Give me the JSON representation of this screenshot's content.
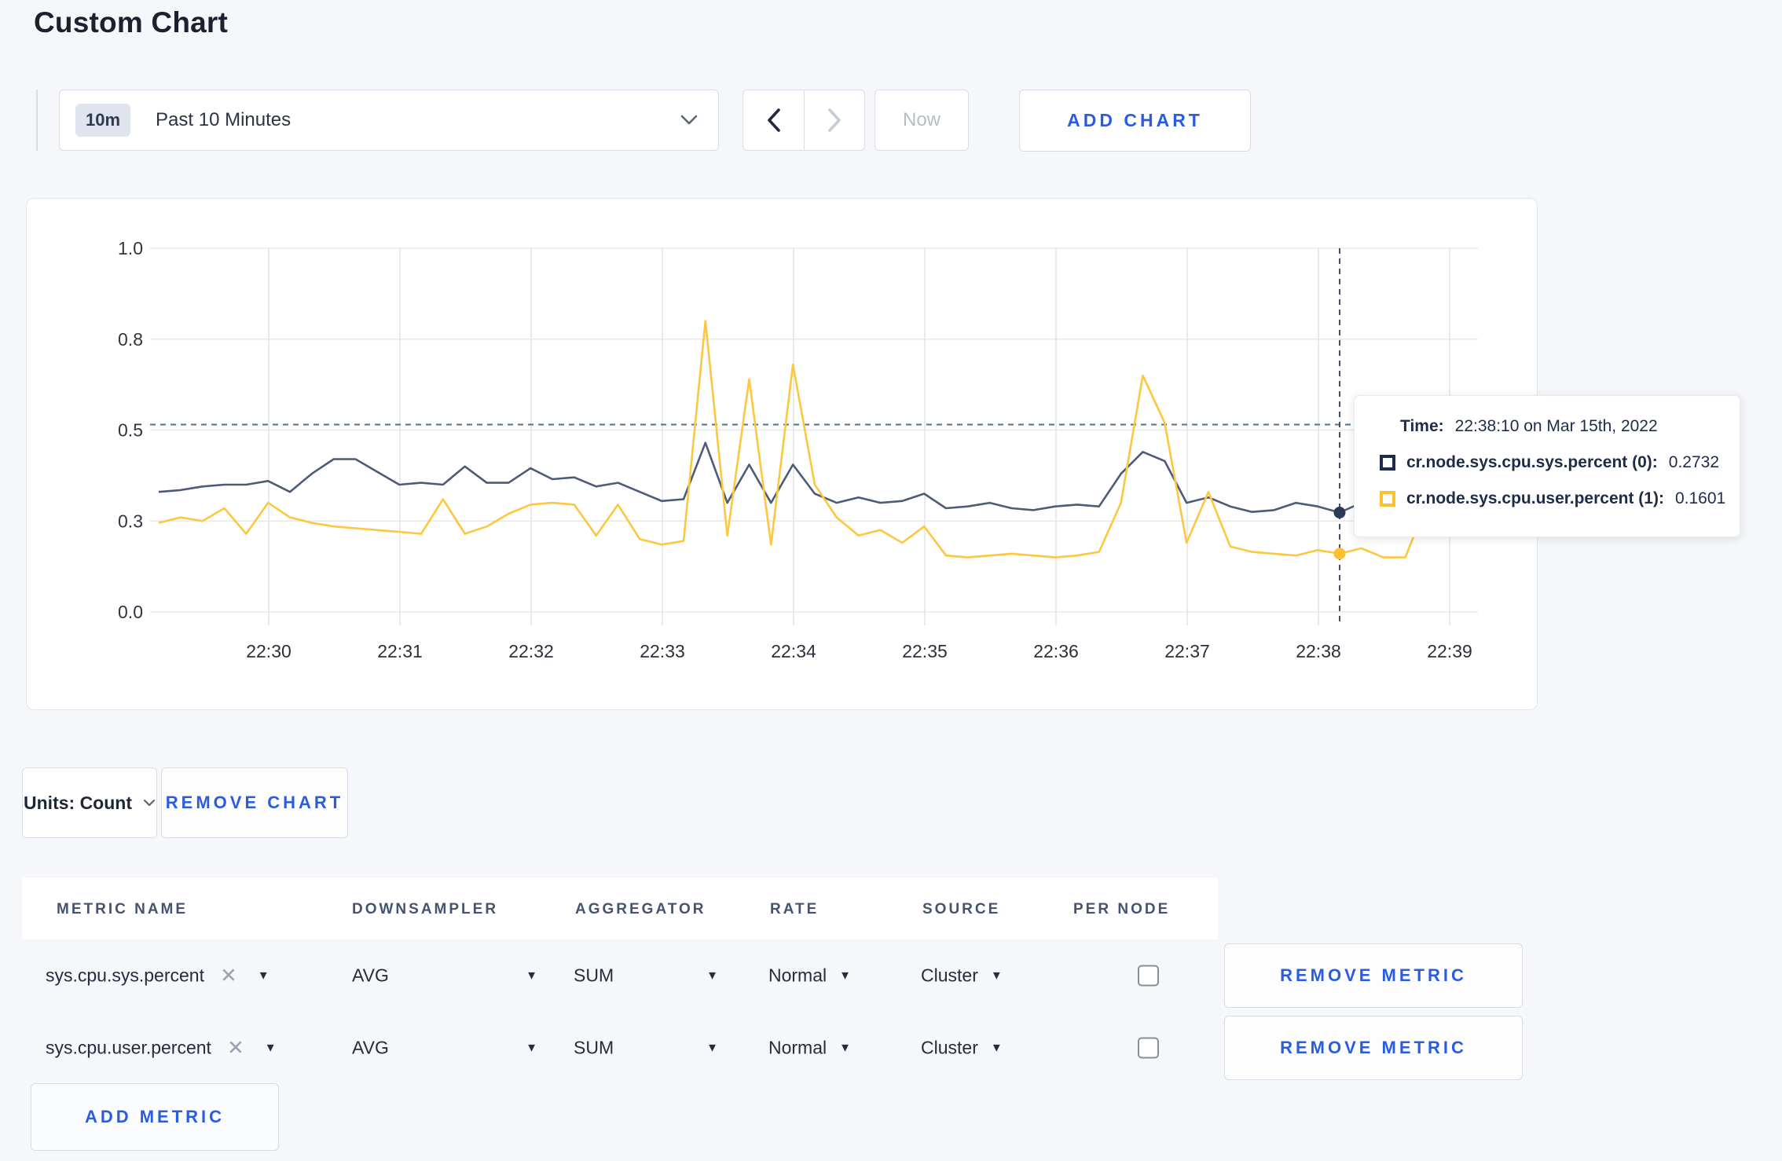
{
  "page": {
    "title": "Custom Chart",
    "background": "#f5f7fa",
    "accent_blue": "#2a5ce0"
  },
  "toolbar": {
    "time_range": {
      "badge": "10m",
      "label": "Past 10 Minutes"
    },
    "now_label": "Now",
    "add_chart_label": "ADD CHART"
  },
  "chart_data": {
    "type": "line",
    "title": "",
    "xlabel": "",
    "ylabel": "",
    "ylim": [
      0,
      1
    ],
    "grid": true,
    "start_time": "22:29:10",
    "interval_seconds": 10,
    "x_tick_labels": [
      "22:30",
      "22:31",
      "22:32",
      "22:33",
      "22:34",
      "22:35",
      "22:36",
      "22:37",
      "22:38",
      "22:39"
    ],
    "y_ticks": [
      {
        "label": "0.0",
        "value": 0.0
      },
      {
        "label": "0.3",
        "value": 0.25
      },
      {
        "label": "0.5",
        "value": 0.5
      },
      {
        "label": "0.8",
        "value": 0.75
      },
      {
        "label": "1.0",
        "value": 1.0
      }
    ],
    "series": [
      {
        "name": "cr.node.sys.cpu.sys.percent",
        "color": "#4d5b79",
        "values": [
          0.33,
          0.335,
          0.345,
          0.35,
          0.35,
          0.36,
          0.33,
          0.38,
          0.42,
          0.42,
          0.385,
          0.35,
          0.355,
          0.35,
          0.4,
          0.355,
          0.355,
          0.395,
          0.365,
          0.37,
          0.345,
          0.355,
          0.33,
          0.305,
          0.31,
          0.465,
          0.3,
          0.405,
          0.3,
          0.405,
          0.325,
          0.3,
          0.315,
          0.3,
          0.305,
          0.325,
          0.285,
          0.29,
          0.3,
          0.285,
          0.28,
          0.29,
          0.295,
          0.29,
          0.38,
          0.44,
          0.415,
          0.3,
          0.315,
          0.29,
          0.275,
          0.28,
          0.3,
          0.29,
          0.2732,
          0.3,
          0.295,
          0.29,
          0.3,
          0.295,
          0.3
        ]
      },
      {
        "name": "cr.node.sys.cpu.user.percent",
        "color": "#fdc73f",
        "values": [
          0.245,
          0.26,
          0.25,
          0.285,
          0.215,
          0.3,
          0.26,
          0.245,
          0.235,
          0.23,
          0.225,
          0.22,
          0.215,
          0.31,
          0.215,
          0.235,
          0.27,
          0.295,
          0.3,
          0.295,
          0.21,
          0.295,
          0.2,
          0.185,
          0.195,
          0.8,
          0.21,
          0.64,
          0.185,
          0.68,
          0.35,
          0.26,
          0.21,
          0.225,
          0.19,
          0.235,
          0.155,
          0.15,
          0.155,
          0.16,
          0.155,
          0.15,
          0.155,
          0.165,
          0.3,
          0.65,
          0.52,
          0.19,
          0.33,
          0.18,
          0.165,
          0.16,
          0.155,
          0.17,
          0.1601,
          0.175,
          0.15,
          0.15,
          0.3,
          0.22,
          0.27
        ]
      }
    ],
    "crosshair": {
      "index": 54,
      "time": "22:38:10",
      "hline_value": 0.515
    },
    "legend_position": "tooltip"
  },
  "tooltip": {
    "time_label": "Time:",
    "time_value": "22:38:10 on Mar 15th, 2022",
    "rows": [
      {
        "swatch_color": "#1e2c49",
        "label": "cr.node.sys.cpu.sys.percent (0):",
        "value": "0.2732"
      },
      {
        "swatch_color": "#fdc030",
        "label": "cr.node.sys.cpu.user.percent (1):",
        "value": "0.1601"
      }
    ]
  },
  "chart_controls": {
    "units_label": "Units: Count",
    "remove_chart_label": "REMOVE CHART"
  },
  "metrics_table": {
    "headers": [
      "METRIC NAME",
      "DOWNSAMPLER",
      "AGGREGATOR",
      "RATE",
      "SOURCE",
      "PER NODE"
    ],
    "rows": [
      {
        "metric": "sys.cpu.sys.percent",
        "downsampler": "AVG",
        "aggregator": "SUM",
        "rate": "Normal",
        "source": "Cluster",
        "per_node": false,
        "remove_label": "REMOVE METRIC"
      },
      {
        "metric": "sys.cpu.user.percent",
        "downsampler": "AVG",
        "aggregator": "SUM",
        "rate": "Normal",
        "source": "Cluster",
        "per_node": false,
        "remove_label": "REMOVE METRIC"
      }
    ],
    "add_metric_label": "ADD METRIC"
  }
}
